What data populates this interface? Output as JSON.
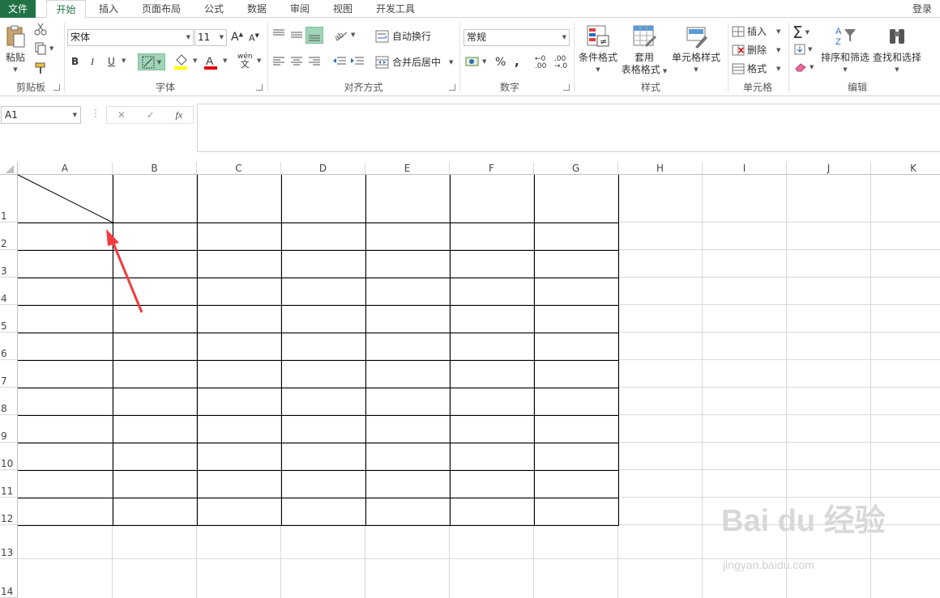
{
  "tabs": [
    {
      "label": "文件"
    },
    {
      "label": "开始"
    },
    {
      "label": "插入"
    },
    {
      "label": "页面布局"
    },
    {
      "label": "公式"
    },
    {
      "label": "数据"
    },
    {
      "label": "审阅"
    },
    {
      "label": "视图"
    },
    {
      "label": "开发工具"
    }
  ],
  "login_label": "登录",
  "clipboard": {
    "paste_label": "粘贴",
    "group_label": "剪贴板"
  },
  "font": {
    "family": "宋体",
    "size": "11",
    "bold": "B",
    "italic": "I",
    "underline": "U",
    "group_label": "字体",
    "wen_label": "wén"
  },
  "alignment": {
    "wrap_label": "自动换行",
    "merge_label": "合并后居中",
    "group_label": "对齐方式"
  },
  "number": {
    "format": "常规",
    "percent": "%",
    "comma": ",",
    "group_label": "数字"
  },
  "styles": {
    "cond_label": "条件格式",
    "table_label_1": "套用",
    "table_label_2": "表格格式",
    "cell_label": "单元格样式",
    "group_label": "样式"
  },
  "cells": {
    "insert_label": "插入",
    "delete_label": "删除",
    "format_label": "格式",
    "group_label": "单元格"
  },
  "editing": {
    "sort_label": "排序和筛选",
    "find_label": "查找和选择",
    "group_label": "编辑"
  },
  "formula_bar": {
    "name_box": "A1",
    "fx": "fx",
    "formula": ""
  },
  "grid": {
    "columns": [
      "A",
      "B",
      "C",
      "D",
      "E",
      "F",
      "G",
      "H",
      "I",
      "J",
      "K"
    ],
    "rows": [
      "1",
      "2",
      "3",
      "4",
      "5",
      "6",
      "7",
      "8",
      "9",
      "10",
      "11",
      "12",
      "13",
      "14"
    ]
  },
  "watermark": {
    "main": "Bai du 经验",
    "sub": "jingyan.baidu.com"
  },
  "colors": {
    "excel_green": "#217346",
    "annotation_red": "#f03c3c"
  }
}
